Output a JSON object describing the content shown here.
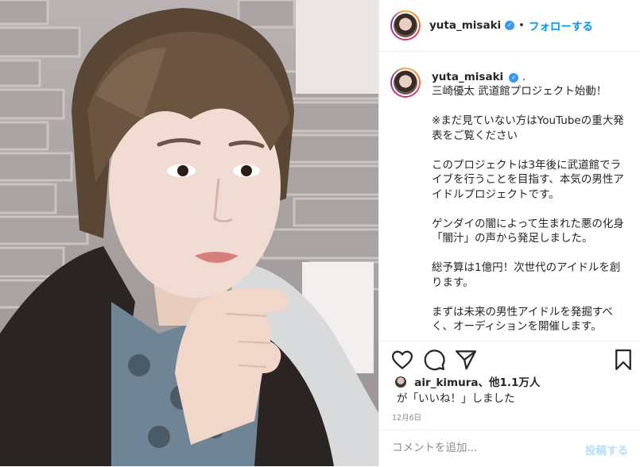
{
  "post": {
    "username": "yuta_misaki",
    "header_separator": "•",
    "follow_label": "フォローする",
    "caption_username": "yuta_misaki",
    "caption_dot": ".",
    "caption": "三崎優太 武道館プロジェクト始動！\n\n※まだ見ていない方はYouTubeの重大発表をご覧ください\n\nこのプロジェクトは3年後に武道館でライブを行うことを目指す、本気の男性アイドルプロジェクトです。\n\nゲンダイの闇によって生まれた悪の化身「闇汁」の声から発足しました。\n\n総予算は1億円！次世代のアイドルを創ります。\n\nまずは未来の男性アイドルを発掘すべく、オーディションを開催します。"
  },
  "likes": {
    "liker": "air_kimura",
    "others": "、他1.1万人",
    "suffix": "が「いいね！」しました"
  },
  "date": "12月6日",
  "comment": {
    "placeholder": "コメントを追加...",
    "post_label": "投稿する"
  },
  "icons": {
    "like": "heart-icon",
    "comment": "comment-bubble-icon",
    "share": "paper-plane-icon",
    "save": "bookmark-icon"
  }
}
